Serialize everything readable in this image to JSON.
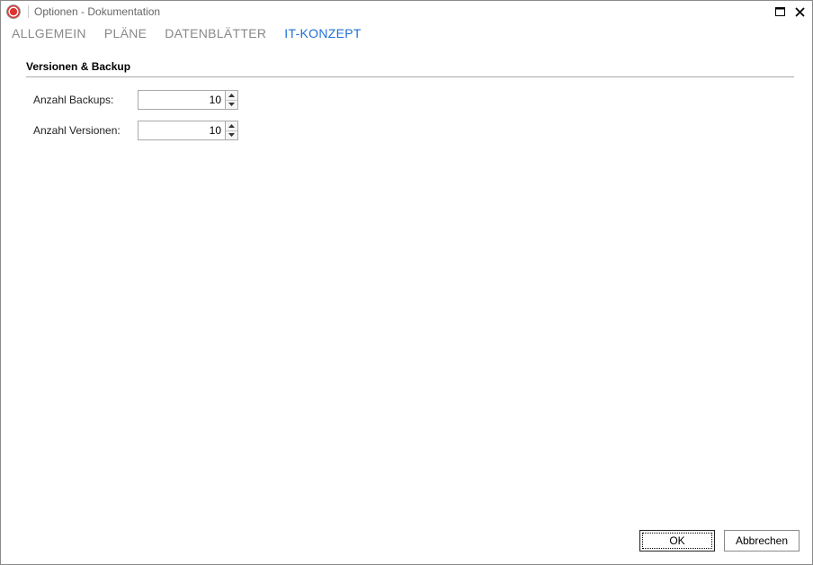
{
  "window": {
    "title": "Optionen - Dokumentation"
  },
  "tabs": {
    "allgemein": "ALLGEMEIN",
    "plaene": "PLÄNE",
    "datenblaetter": "DATENBLÄTTER",
    "itkonzept": "IT-KONZEPT"
  },
  "section": {
    "title": "Versionen & Backup"
  },
  "fields": {
    "backups": {
      "label": "Anzahl Backups:",
      "value": "10"
    },
    "versionen": {
      "label": "Anzahl Versionen:",
      "value": "10"
    }
  },
  "buttons": {
    "ok": "OK",
    "cancel": "Abbrechen"
  }
}
